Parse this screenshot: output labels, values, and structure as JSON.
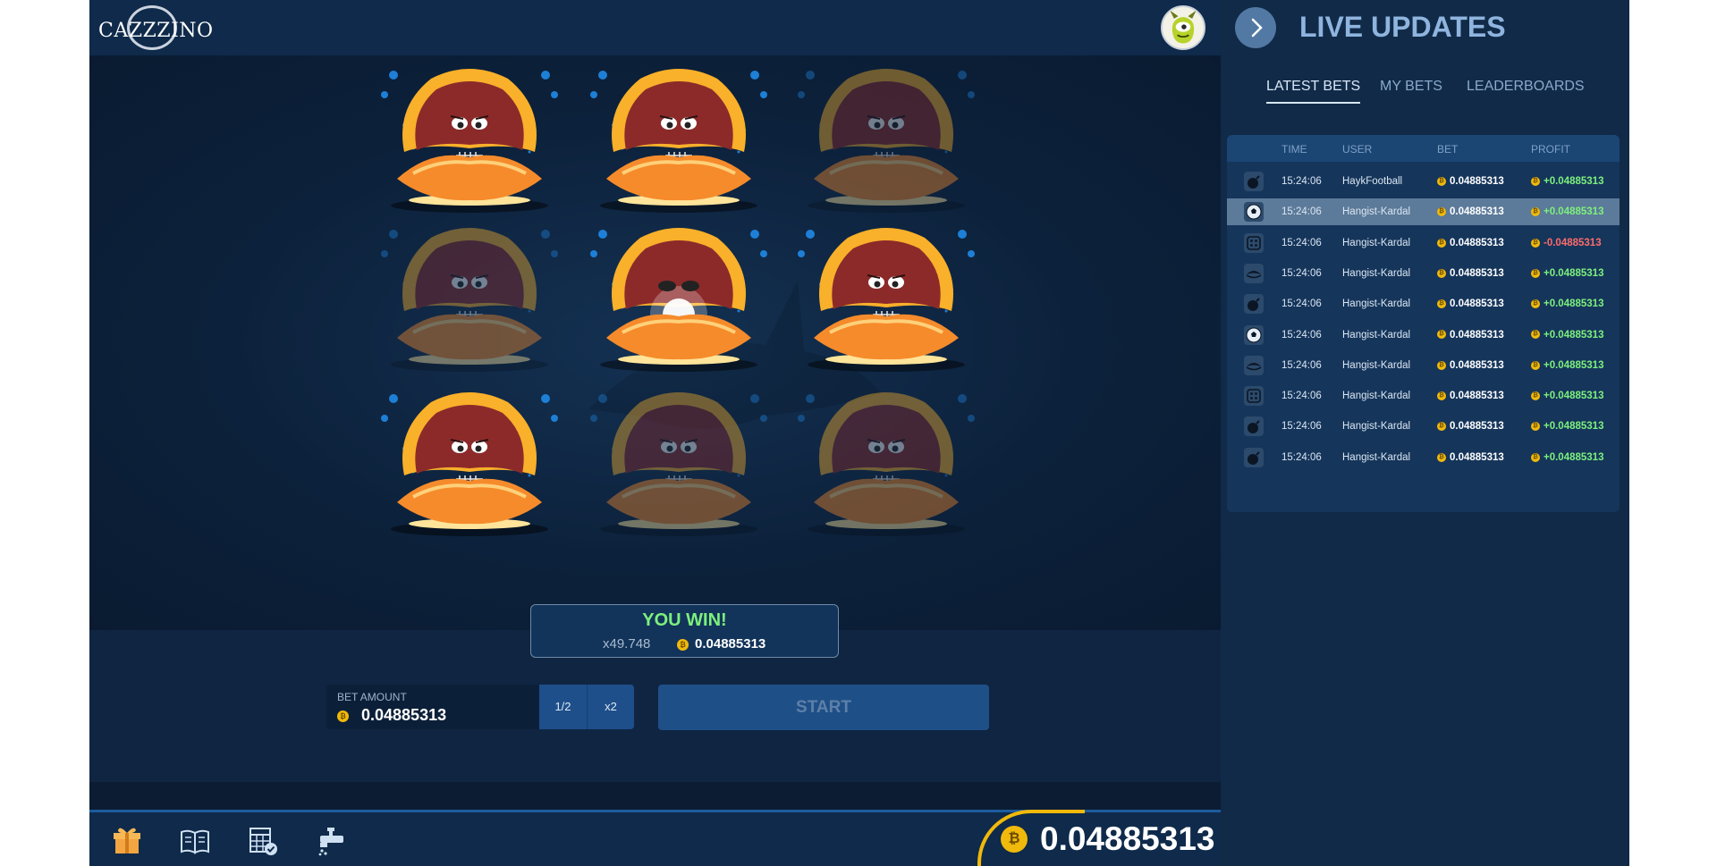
{
  "brand": {
    "logo_text": "CAZZZINO"
  },
  "game": {
    "result": {
      "title": "YOU WIN!",
      "multiplier": "x49.748",
      "amount": "0.04885313"
    },
    "bet": {
      "label": "BET AMOUNT",
      "value": "0.04885313",
      "half_label": "1/2",
      "double_label": "x2"
    },
    "start_label": "START",
    "tiles": [
      {
        "state": "sad",
        "dim": false
      },
      {
        "state": "sad",
        "dim": false
      },
      {
        "state": "sad",
        "dim": true
      },
      {
        "state": "sad",
        "dim": true
      },
      {
        "state": "pearl",
        "dim": false
      },
      {
        "state": "sad",
        "dim": false
      },
      {
        "state": "sad",
        "dim": false
      },
      {
        "state": "sad",
        "dim": true
      },
      {
        "state": "sad",
        "dim": true
      }
    ]
  },
  "footer": {
    "icons": [
      "gift-icon",
      "book-icon",
      "calculator-check-icon",
      "faucet-icon"
    ],
    "balance": "0.04885313"
  },
  "sidebar": {
    "title": "LIVE UPDATES",
    "tabs": [
      {
        "label": "LATEST BETS",
        "active": true
      },
      {
        "label": "MY BETS",
        "active": false
      },
      {
        "label": "LEADERBOARDS",
        "active": false
      }
    ],
    "columns": [
      "TIME",
      "USER",
      "BET",
      "PROFIT"
    ],
    "rows": [
      {
        "icon": "bomb-icon",
        "time": "15:24:06",
        "user": "HaykFootball",
        "bet": "0.04885313",
        "profit": "+0.04885313",
        "positive": true,
        "highlight": false
      },
      {
        "icon": "soccer-ball-icon",
        "time": "15:24:06",
        "user": "Hangist-Kardal",
        "bet": "0.04885313",
        "profit": "+0.04885313",
        "positive": true,
        "highlight": true
      },
      {
        "icon": "dice-icon",
        "time": "15:24:06",
        "user": "Hangist-Kardal",
        "bet": "0.04885313",
        "profit": "-0.04885313",
        "positive": false,
        "highlight": false
      },
      {
        "icon": "clam-icon",
        "time": "15:24:06",
        "user": "Hangist-Kardal",
        "bet": "0.04885313",
        "profit": "+0.04885313",
        "positive": true,
        "highlight": false
      },
      {
        "icon": "bomb-icon",
        "time": "15:24:06",
        "user": "Hangist-Kardal",
        "bet": "0.04885313",
        "profit": "+0.04885313",
        "positive": true,
        "highlight": false
      },
      {
        "icon": "soccer-ball-icon",
        "time": "15:24:06",
        "user": "Hangist-Kardal",
        "bet": "0.04885313",
        "profit": "+0.04885313",
        "positive": true,
        "highlight": false
      },
      {
        "icon": "clam-icon",
        "time": "15:24:06",
        "user": "Hangist-Kardal",
        "bet": "0.04885313",
        "profit": "+0.04885313",
        "positive": true,
        "highlight": false
      },
      {
        "icon": "dice-icon",
        "time": "15:24:06",
        "user": "Hangist-Kardal",
        "bet": "0.04885313",
        "profit": "+0.04885313",
        "positive": true,
        "highlight": false
      },
      {
        "icon": "bomb-icon",
        "time": "15:24:06",
        "user": "Hangist-Kardal",
        "bet": "0.04885313",
        "profit": "+0.04885313",
        "positive": true,
        "highlight": false
      },
      {
        "icon": "bomb-icon",
        "time": "15:24:06",
        "user": "Hangist-Kardal",
        "bet": "0.04885313",
        "profit": "+0.04885313",
        "positive": true,
        "highlight": false
      }
    ]
  },
  "colors": {
    "accent_gold": "#f0b90b",
    "profit_positive": "#7df07d",
    "profit_negative": "#ff6b6b",
    "primary_button": "#1f4f87"
  }
}
